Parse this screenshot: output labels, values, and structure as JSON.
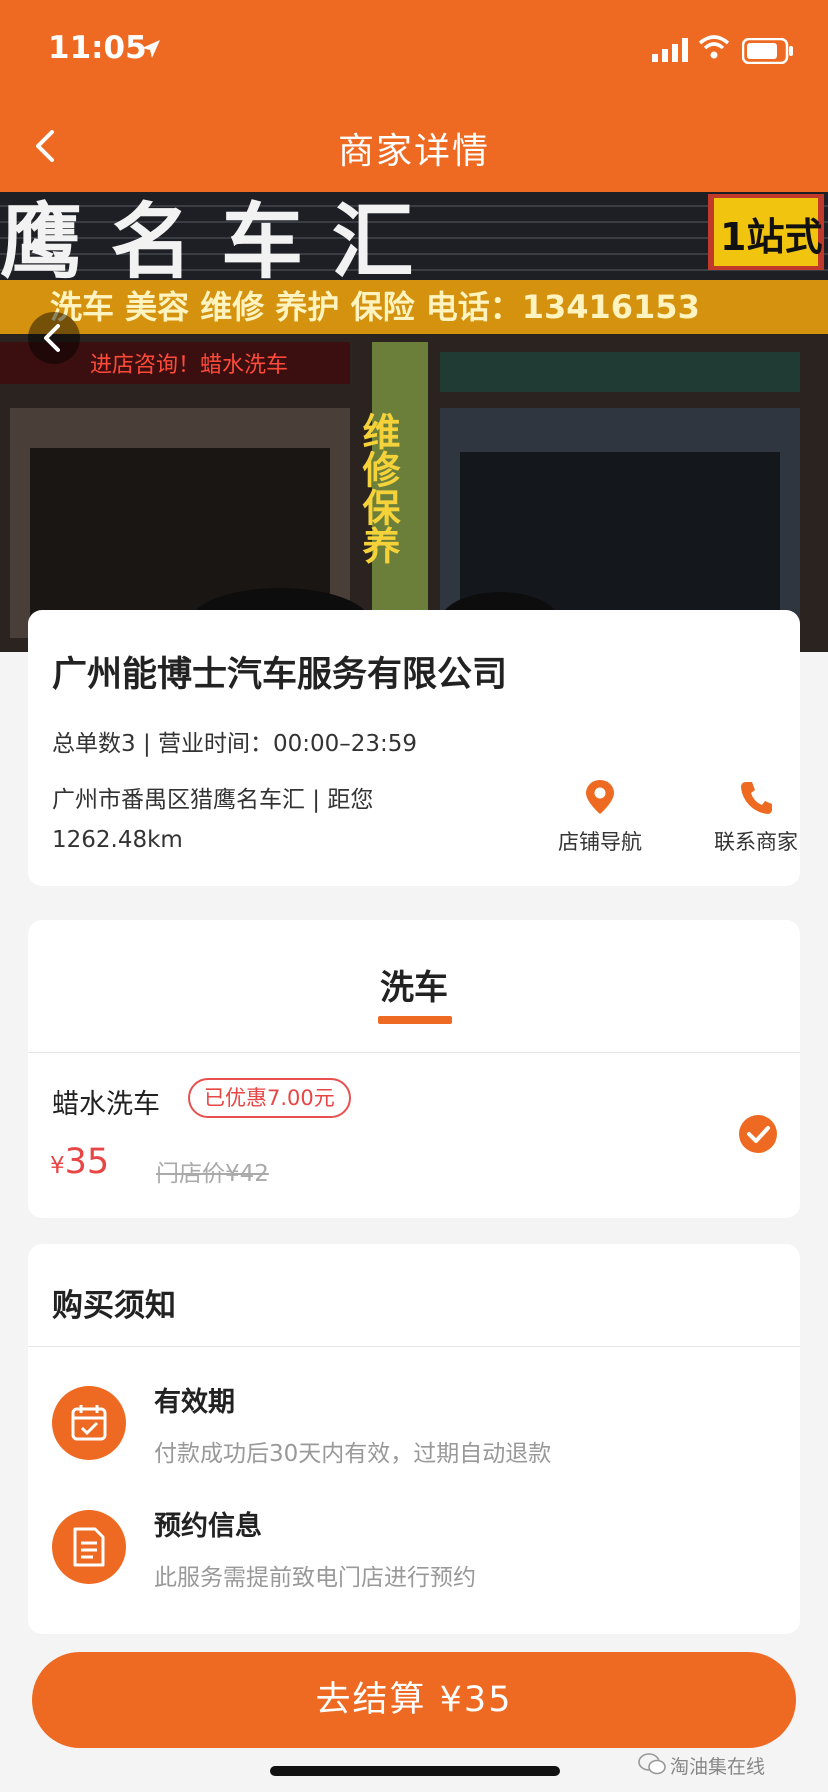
{
  "status_bar": {
    "time": "11:05",
    "icons": [
      "location-arrow-icon",
      "signal-icon",
      "wifi-icon",
      "battery-icon"
    ]
  },
  "nav": {
    "title": "商家详情",
    "back_icon": "chevron-left-icon"
  },
  "hero": {
    "sign_main": "鹰 名 车 汇",
    "sign_sub": "洗车 美容 维修 养护 保险 电话：13416153",
    "sign_red": "进店咨询！蜡水洗车",
    "sign_badge": "1站式",
    "sign_vertical": "维修保养"
  },
  "shop": {
    "name": "广州能博士汽车服务有限公司",
    "meta": "总单数3 | 营业时间：00:00–23:59",
    "address": "广州市番禺区猎鹰名车汇 | 距您",
    "distance": "1262.48km",
    "nav_label": "店铺导航",
    "call_label": "联系商家"
  },
  "service": {
    "tab": "洗车",
    "item_name": "蜡水洗车",
    "discount_badge": "已优惠7.00元",
    "currency": "¥",
    "price": "35",
    "original_price": "门店价¥42",
    "selected": true
  },
  "notice": {
    "title": "购买须知",
    "items": [
      {
        "title": "有效期",
        "desc": "付款成功后30天内有效，过期自动退款",
        "icon": "calendar-icon"
      },
      {
        "title": "预约信息",
        "desc": "此服务需提前致电门店进行预约",
        "icon": "document-icon"
      }
    ]
  },
  "checkout": {
    "label": "去结算 ¥35"
  },
  "watermark": "淘油集在线",
  "colors": {
    "brand": "#ee6a22",
    "price_red": "#e84545",
    "background": "#f4f4f4"
  }
}
